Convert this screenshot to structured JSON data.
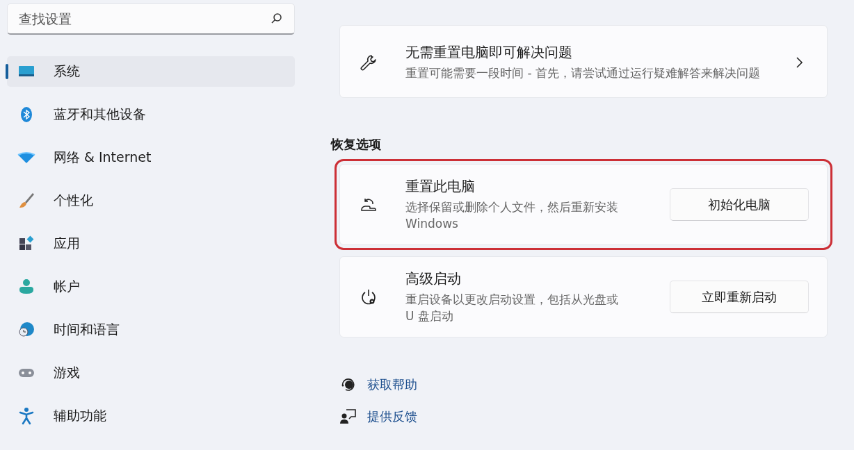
{
  "search": {
    "placeholder": "查找设置"
  },
  "sidebar": {
    "items": [
      {
        "label": "系统",
        "selected": true
      },
      {
        "label": "蓝牙和其他设备",
        "selected": false
      },
      {
        "label": "网络 & Internet",
        "selected": false
      },
      {
        "label": "个性化",
        "selected": false
      },
      {
        "label": "应用",
        "selected": false
      },
      {
        "label": "帐户",
        "selected": false
      },
      {
        "label": "时间和语言",
        "selected": false
      },
      {
        "label": "游戏",
        "selected": false
      },
      {
        "label": "辅助功能",
        "selected": false
      }
    ]
  },
  "cards": [
    {
      "kind": "link",
      "title": "无需重置电脑即可解决问题",
      "description": "重置可能需要一段时间 - 首先，请尝试通过运行疑难解答来解决问题",
      "highlighted": false
    }
  ],
  "section": {
    "title": "恢复选项",
    "cards": [
      {
        "kind": "button",
        "title": "重置此电脑",
        "description": "选择保留或删除个人文件，然后重新安装 Windows",
        "button": "初始化电脑",
        "highlighted": true
      },
      {
        "kind": "button",
        "title": "高级启动",
        "description": "重启设备以更改启动设置，包括从光盘或 U 盘启动",
        "button": "立即重新启动",
        "highlighted": false
      }
    ]
  },
  "links": [
    {
      "label": "获取帮助"
    },
    {
      "label": "提供反馈"
    }
  ]
}
